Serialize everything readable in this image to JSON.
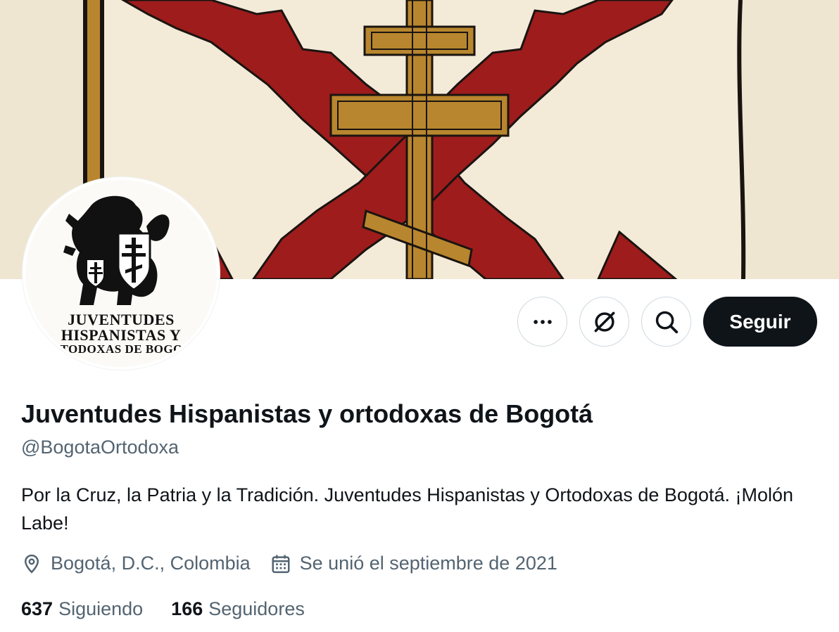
{
  "profile": {
    "display_name": "Juventudes Hispanistas y ortodoxas de Bogotá",
    "handle": "@BogotaOrtodoxa",
    "bio": "Por la Cruz, la Patria y la Tradición. Juventudes Hispanistas y Ortodoxas de Bogotá. ¡Molón Labe!",
    "location": "Bogotá, D.C., Colombia",
    "joined": "Se unió el septiembre de 2021"
  },
  "avatar": {
    "line1": "JUVENTUDES",
    "line2": "HISPANISTAS Y",
    "line3": "ORTODOXAS DE BOGOTÁ"
  },
  "actions": {
    "more_icon": "more-horizontal-icon",
    "grok_icon": "grok-icon",
    "search_icon": "search-icon",
    "follow_label": "Seguir"
  },
  "stats": {
    "following_count": "637",
    "following_label": "Siguiendo",
    "followers_count": "166",
    "followers_label": "Seguidores"
  },
  "colors": {
    "primary_text": "#0f1419",
    "secondary_text": "#536471",
    "banner_background": "#efe6d2",
    "saltire_red": "#9e1c1c",
    "cross_gold": "#b8862e"
  }
}
